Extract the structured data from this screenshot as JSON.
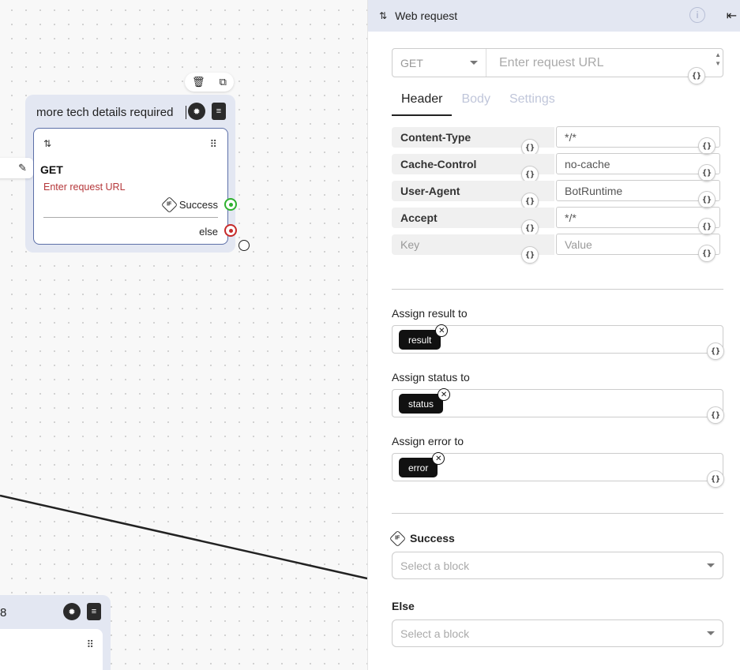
{
  "canvas": {
    "group_title": "more tech details required",
    "node": {
      "method": "GET",
      "url_placeholder": "Enter request URL",
      "success_label": "Success",
      "else_label": "else"
    },
    "group2_title": "8"
  },
  "panel": {
    "title": "Web request",
    "method": "GET",
    "url_placeholder": "Enter request URL",
    "tabs": [
      "Header",
      "Body",
      "Settings"
    ],
    "headers": [
      {
        "key": "Content-Type",
        "value": "*/*"
      },
      {
        "key": "Cache-Control",
        "value": "no-cache"
      },
      {
        "key": "User-Agent",
        "value": "BotRuntime"
      },
      {
        "key": "Accept",
        "value": "*/*"
      }
    ],
    "header_placeholder": {
      "key": "Key",
      "value": "Value"
    },
    "assign_result": {
      "label": "Assign result to",
      "chip": "result"
    },
    "assign_status": {
      "label": "Assign status to",
      "chip": "status"
    },
    "assign_error": {
      "label": "Assign error to",
      "chip": "error"
    },
    "success": {
      "label": "Success",
      "placeholder": "Select a block"
    },
    "else": {
      "label": "Else",
      "placeholder": "Select a block"
    },
    "variable_icon": "{}"
  }
}
